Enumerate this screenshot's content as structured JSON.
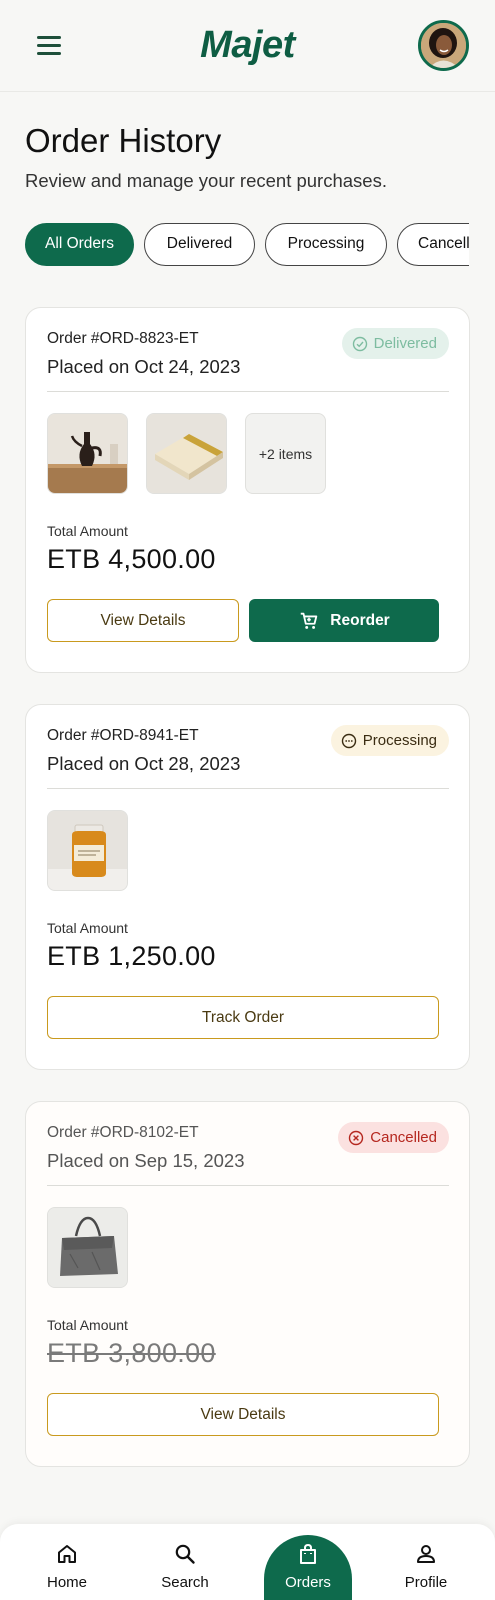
{
  "app": {
    "brand": "Majet"
  },
  "header": {
    "title": "Order History",
    "subtitle": "Review and manage your recent purchases."
  },
  "filters": [
    {
      "label": "All Orders",
      "active": true
    },
    {
      "label": "Delivered",
      "active": false
    },
    {
      "label": "Processing",
      "active": false
    },
    {
      "label": "Cancelled",
      "active": false
    }
  ],
  "orders": [
    {
      "id": "Order #ORD-8823-ET",
      "placed": "Placed on Oct 24, 2023",
      "status": "Delivered",
      "status_icon": "check-circle-icon",
      "more_items": "+2 items",
      "total_label": "Total Amount",
      "total": "ETB 4,500.00",
      "primary_action": "View Details",
      "secondary_action": "Reorder"
    },
    {
      "id": "Order #ORD-8941-ET",
      "placed": "Placed on Oct 28, 2023",
      "status": "Processing",
      "status_icon": "ellipsis-circle-icon",
      "total_label": "Total Amount",
      "total": "ETB 1,250.00",
      "primary_action": "Track Order"
    },
    {
      "id": "Order #ORD-8102-ET",
      "placed": "Placed on Sep 15, 2023",
      "status": "Cancelled",
      "status_icon": "x-circle-icon",
      "total_label": "Total Amount",
      "total": "ETB 3,800.00",
      "primary_action": "View Details"
    }
  ],
  "nav": [
    {
      "label": "Home",
      "icon": "home-icon",
      "active": false
    },
    {
      "label": "Search",
      "icon": "search-icon",
      "active": false
    },
    {
      "label": "Orders",
      "icon": "shopping-bag-icon",
      "active": true
    },
    {
      "label": "Profile",
      "icon": "user-icon",
      "active": false
    }
  ],
  "colors": {
    "brand_green": "#0e6a4c",
    "gold_outline": "#c99a1e",
    "delivered_bg": "#e4f1eb",
    "processing_bg": "#fbf3e0",
    "cancelled_bg": "#fbe1e0"
  }
}
